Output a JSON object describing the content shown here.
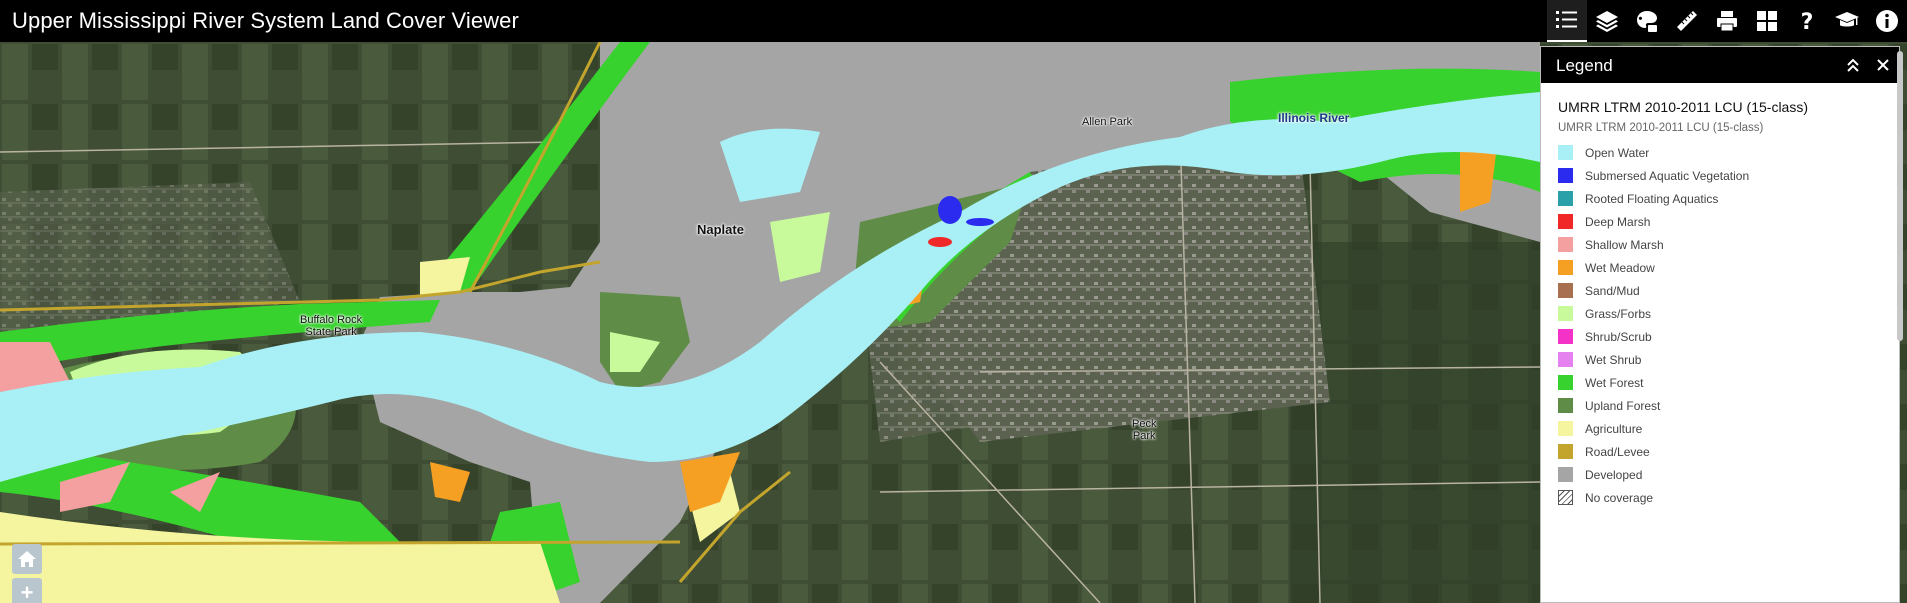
{
  "app": {
    "title": "Upper Mississippi River System Land Cover Viewer"
  },
  "toolbar": {
    "items": [
      {
        "icon": "legend-list-icon",
        "active": true
      },
      {
        "icon": "layers-icon"
      },
      {
        "icon": "basemap-gallery-icon"
      },
      {
        "icon": "measure-ruler-icon"
      },
      {
        "icon": "print-icon"
      },
      {
        "icon": "widget-grid-icon"
      },
      {
        "icon": "help-question-icon"
      },
      {
        "icon": "tutorial-mortarboard-icon"
      },
      {
        "icon": "info-icon"
      }
    ]
  },
  "map": {
    "labels": {
      "naplate": "Naplate",
      "allen_park": "Allen Park",
      "illinois_river": "Illinois River",
      "buffalo_rock_1": "Buffalo Rock",
      "buffalo_rock_2": "State Park",
      "peck_park_1": "Peck",
      "peck_park_2": "Park"
    },
    "controls": {
      "home": "home-icon",
      "zoom_in": "+"
    }
  },
  "legend": {
    "title": "Legend",
    "layer_title": "UMRR LTRM 2010-2011 LCU (15-class)",
    "layer_subtitle": "UMRR LTRM 2010-2011 LCU (15-class)",
    "items": [
      {
        "label": "Open Water",
        "color": "#a8f0f5"
      },
      {
        "label": "Submersed Aquatic Vegetation",
        "color": "#2b2bf0"
      },
      {
        "label": "Rooted Floating Aquatics",
        "color": "#2aa0a8"
      },
      {
        "label": "Deep Marsh",
        "color": "#f02828"
      },
      {
        "label": "Shallow Marsh",
        "color": "#f5a0a0"
      },
      {
        "label": "Wet Meadow",
        "color": "#f5a023"
      },
      {
        "label": "Sand/Mud",
        "color": "#a87050"
      },
      {
        "label": "Grass/Forbs",
        "color": "#c8fa9b"
      },
      {
        "label": "Shrub/Scrub",
        "color": "#f532c8"
      },
      {
        "label": "Wet Shrub",
        "color": "#e682f0"
      },
      {
        "label": "Wet Forest",
        "color": "#37d22d"
      },
      {
        "label": "Upland Forest",
        "color": "#5f8c46"
      },
      {
        "label": "Agriculture",
        "color": "#f5f5a0"
      },
      {
        "label": "Road/Levee",
        "color": "#c3a52d"
      },
      {
        "label": "Developed",
        "color": "#a5a5a5"
      },
      {
        "label": "No coverage",
        "color": "hatch"
      }
    ]
  }
}
